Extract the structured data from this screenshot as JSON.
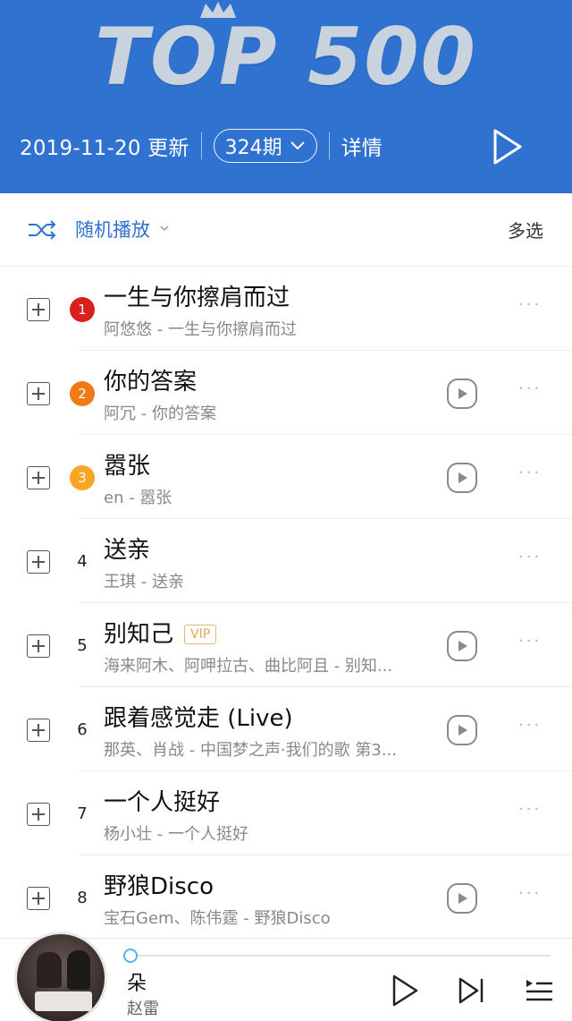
{
  "header": {
    "logo_text": "TOP 500",
    "update_date": "2019-11-20 更新",
    "issue": "324期",
    "detail": "详情",
    "bg_color": "#2f72cf"
  },
  "toolbar": {
    "shuffle_label": "随机播放",
    "multi_select": "多选",
    "accent": "#2f72cf"
  },
  "songs": [
    {
      "rank": "1",
      "title": "一生与你擦肩而过",
      "subtitle": "阿悠悠 - 一生与你擦肩而过",
      "vip": false,
      "has_play": false,
      "badge_color": "#d9201c"
    },
    {
      "rank": "2",
      "title": "你的答案",
      "subtitle": "阿冗 - 你的答案",
      "vip": false,
      "has_play": true,
      "badge_color": "#f07a18"
    },
    {
      "rank": "3",
      "title": "嚣张",
      "subtitle": "en - 嚣张",
      "vip": false,
      "has_play": true,
      "badge_color": "#f5a623"
    },
    {
      "rank": "4",
      "title": "送亲",
      "subtitle": "王琪 - 送亲",
      "vip": false,
      "has_play": false
    },
    {
      "rank": "5",
      "title": "别知己",
      "subtitle": "海来阿木、阿呷拉古、曲比阿且 - 别知...",
      "vip": true,
      "vip_label": "VIP",
      "has_play": true
    },
    {
      "rank": "6",
      "title": "跟着感觉走 (Live)",
      "subtitle": "那英、肖战 - 中国梦之声·我们的歌 第3...",
      "vip": false,
      "has_play": true
    },
    {
      "rank": "7",
      "title": "一个人挺好",
      "subtitle": "杨小壮 - 一个人挺好",
      "vip": false,
      "has_play": false
    },
    {
      "rank": "8",
      "title": "野狼Disco",
      "subtitle": "宝石Gem、陈伟霆 - 野狼Disco",
      "vip": false,
      "has_play": true
    }
  ],
  "player": {
    "title": "朵",
    "artist": "赵雷",
    "progress": 0.0,
    "knob_color": "#48b6e8"
  },
  "icons": {
    "more": "···"
  }
}
